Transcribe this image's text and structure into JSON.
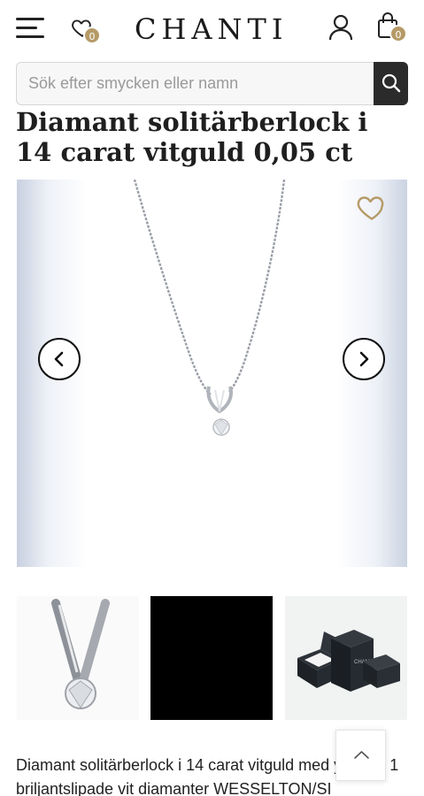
{
  "header": {
    "brand": "CHANTI",
    "wishlist_count": "0",
    "cart_count": "0",
    "icons": [
      "menu-icon",
      "heart-icon",
      "user-icon",
      "shopping-bag-icon"
    ]
  },
  "search": {
    "placeholder": "Sök efter smycken eller namn",
    "value": ""
  },
  "product": {
    "title": "Diamant solitärberlock i 14 carat vitguld 0,05 ct",
    "description": "Diamant solitärberlock i 14 carat vitguld med yta och 1 briljantslipade vit diamanter WESSELTON/SI",
    "thumbnails": [
      {
        "kind": "pendant-closeup"
      },
      {
        "kind": "video-black"
      },
      {
        "kind": "gift-boxes",
        "box_label": "CHANTI"
      }
    ]
  },
  "colors": {
    "accent_gold": "#b59a67",
    "search_button": "#2b2b2b",
    "text": "#1f1f1f"
  }
}
